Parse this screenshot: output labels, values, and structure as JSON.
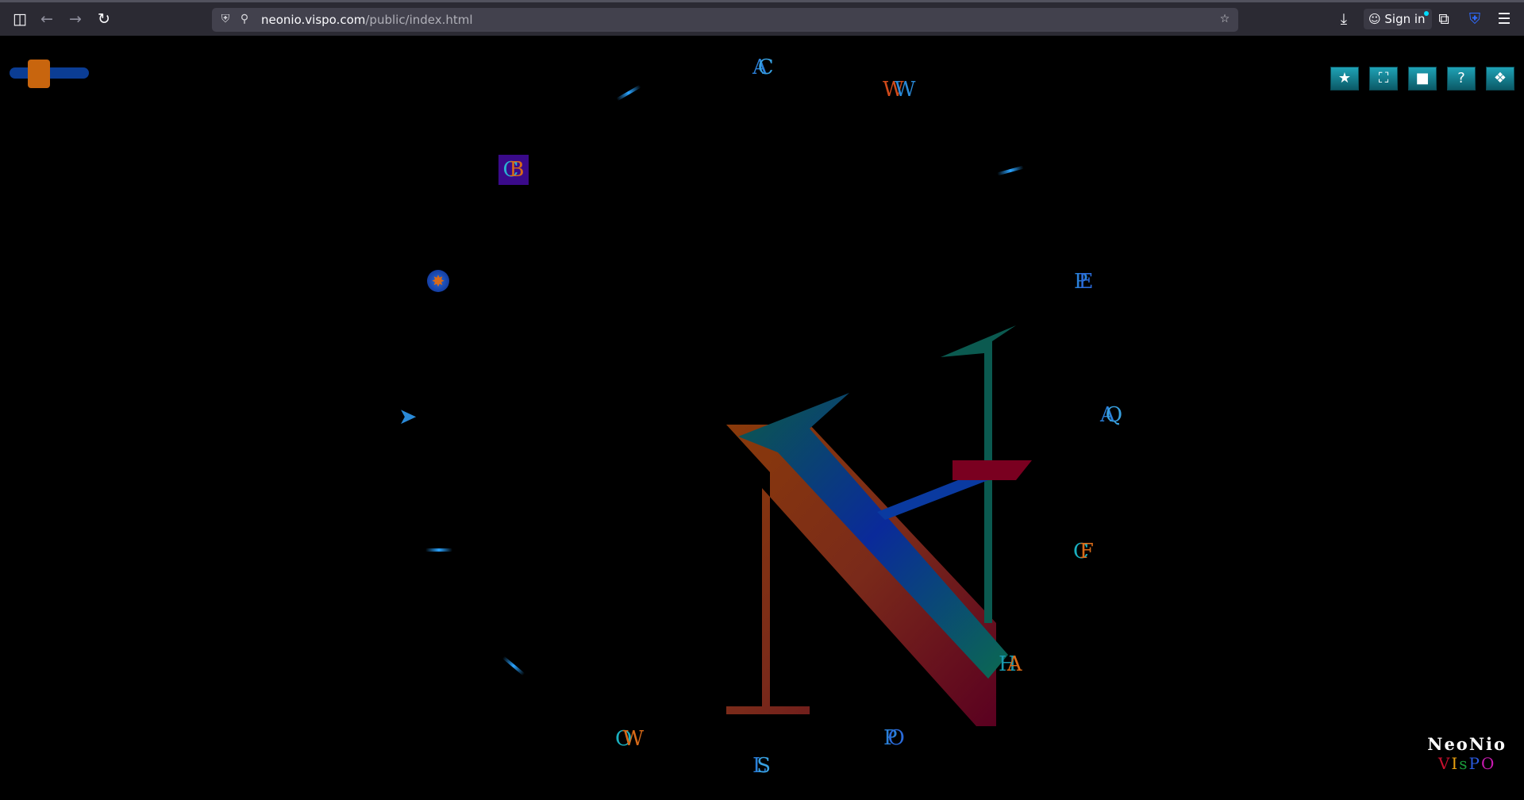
{
  "browser": {
    "url_host": "neonio.vispo.com",
    "url_path": "/public/index.html",
    "sign_in": "Sign in"
  },
  "page": {
    "glyphs": [
      {
        "a": "A",
        "b": "C"
      },
      {
        "a": "W",
        "b": "W"
      },
      {
        "a": "C",
        "b": "B"
      },
      {
        "a": "P",
        "b": "E"
      },
      {
        "a": "A",
        "b": "Q"
      },
      {
        "a": "C",
        "b": "F"
      },
      {
        "a": "H",
        "b": "A"
      },
      {
        "a": "P",
        "b": "O"
      },
      {
        "a": "L",
        "b": "S"
      },
      {
        "a": "O",
        "b": "W"
      }
    ],
    "brand": {
      "title": "NeoNio",
      "sub_v": "V",
      "sub_i": "I",
      "sub_s": "s",
      "sub_p": "P",
      "sub_o": "O"
    }
  },
  "colors": {
    "slider_track": "#0b3d94",
    "slider_thumb": "#c8650e",
    "tool_button": "#1fa2b6"
  },
  "icons": {
    "toolbar": [
      "star-icon",
      "fullscreen-icon",
      "window-icon",
      "help-icon",
      "gift-icon"
    ]
  }
}
